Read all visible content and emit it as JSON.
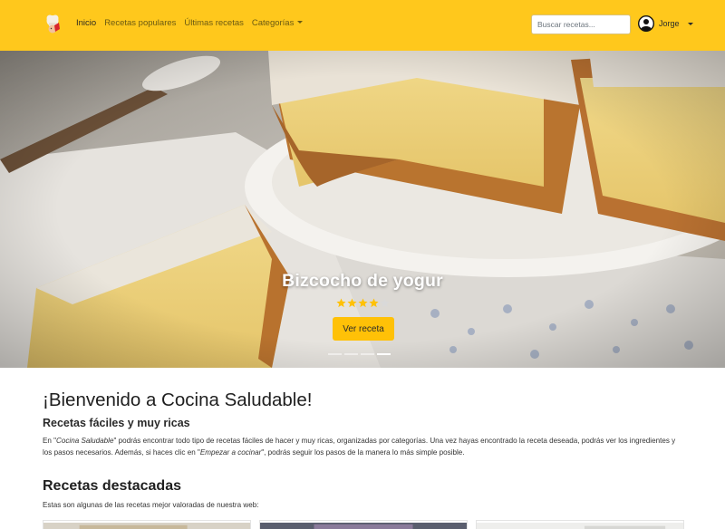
{
  "navbar": {
    "logo_icon": "chef-logo-icon",
    "links": [
      {
        "label": "Inicio",
        "active": true
      },
      {
        "label": "Recetas populares",
        "active": false
      },
      {
        "label": "Últimas recetas",
        "active": false
      },
      {
        "label": "Categorías",
        "active": false,
        "dropdown": true
      }
    ],
    "search_placeholder": "Buscar recetas...",
    "user_name": "Jorge",
    "user_icon": "user-circle-icon",
    "background_color": "#ffc81c"
  },
  "carousel": {
    "slide_title": "Bizcocho de yogur",
    "rating": 4,
    "rating_max": 5,
    "button_label": "Ver receta",
    "slide_count": 4,
    "active_slide": 4
  },
  "welcome": {
    "title": "¡Bienvenido a Cocina Saludable!",
    "subtitle": "Recetas fáciles y muy ricas",
    "text_part1": "En \"",
    "text_em1": "Cocina Saludable",
    "text_part2": "\" podrás encontrar todo tipo de recetas fáciles de hacer y muy ricas, organizadas por categorías. Una vez hayas encontrado la receta deseada, podrás ver los ingredientes y los pasos necesarios. Además, si haces clic en \"",
    "text_em2": "Empezar a cocinar",
    "text_part3": "\", podrás seguir los pasos de la manera lo más simple posible."
  },
  "featured": {
    "title": "Recetas destacadas",
    "description": "Estas son algunas de las recetas mejor valoradas de nuestra web:",
    "cards_visible": 3
  },
  "colors": {
    "accent": "#ffc107",
    "navbar": "#ffc81c"
  }
}
